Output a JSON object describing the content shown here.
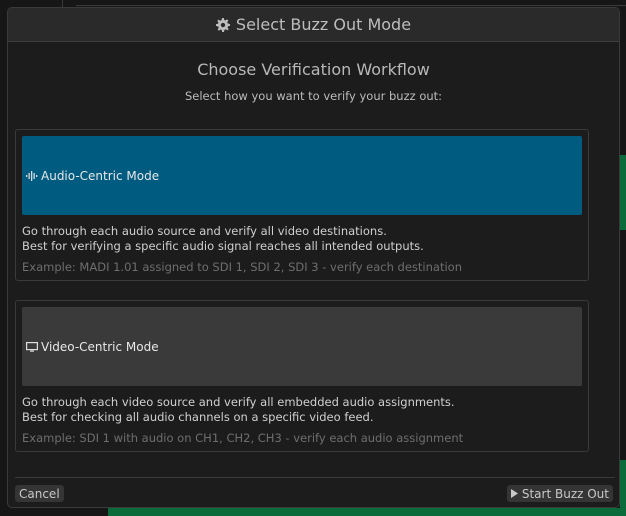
{
  "dialog": {
    "title": "Select Buzz Out Mode",
    "title_icon": "gear-icon",
    "heading": "Choose Verification Workflow",
    "subheading": "Select how you want to verify your buzz out:",
    "modes": [
      {
        "label": "Audio-Centric Mode",
        "icon": "audio-waveform-icon",
        "selected": true,
        "color": "#005b80",
        "description_lines": [
          "Go through each audio source and verify all video destinations.",
          "Best for verifying a specific audio signal reaches all intended outputs."
        ],
        "example": "Example: MADI 1.01 assigned to SDI 1, SDI 2, SDI 3 - verify each destination"
      },
      {
        "label": "Video-Centric Mode",
        "icon": "monitor-icon",
        "selected": false,
        "color": "#3a3a3a",
        "description_lines": [
          "Go through each video source and verify all embedded audio assignments.",
          "Best for checking all audio channels on a specific video feed."
        ],
        "example": "Example: SDI 1 with audio on CH1, CH2, CH3 - verify each audio assignment"
      }
    ],
    "cancel_label": "Cancel",
    "start_label": "Start Buzz Out",
    "start_icon": "play-icon"
  }
}
